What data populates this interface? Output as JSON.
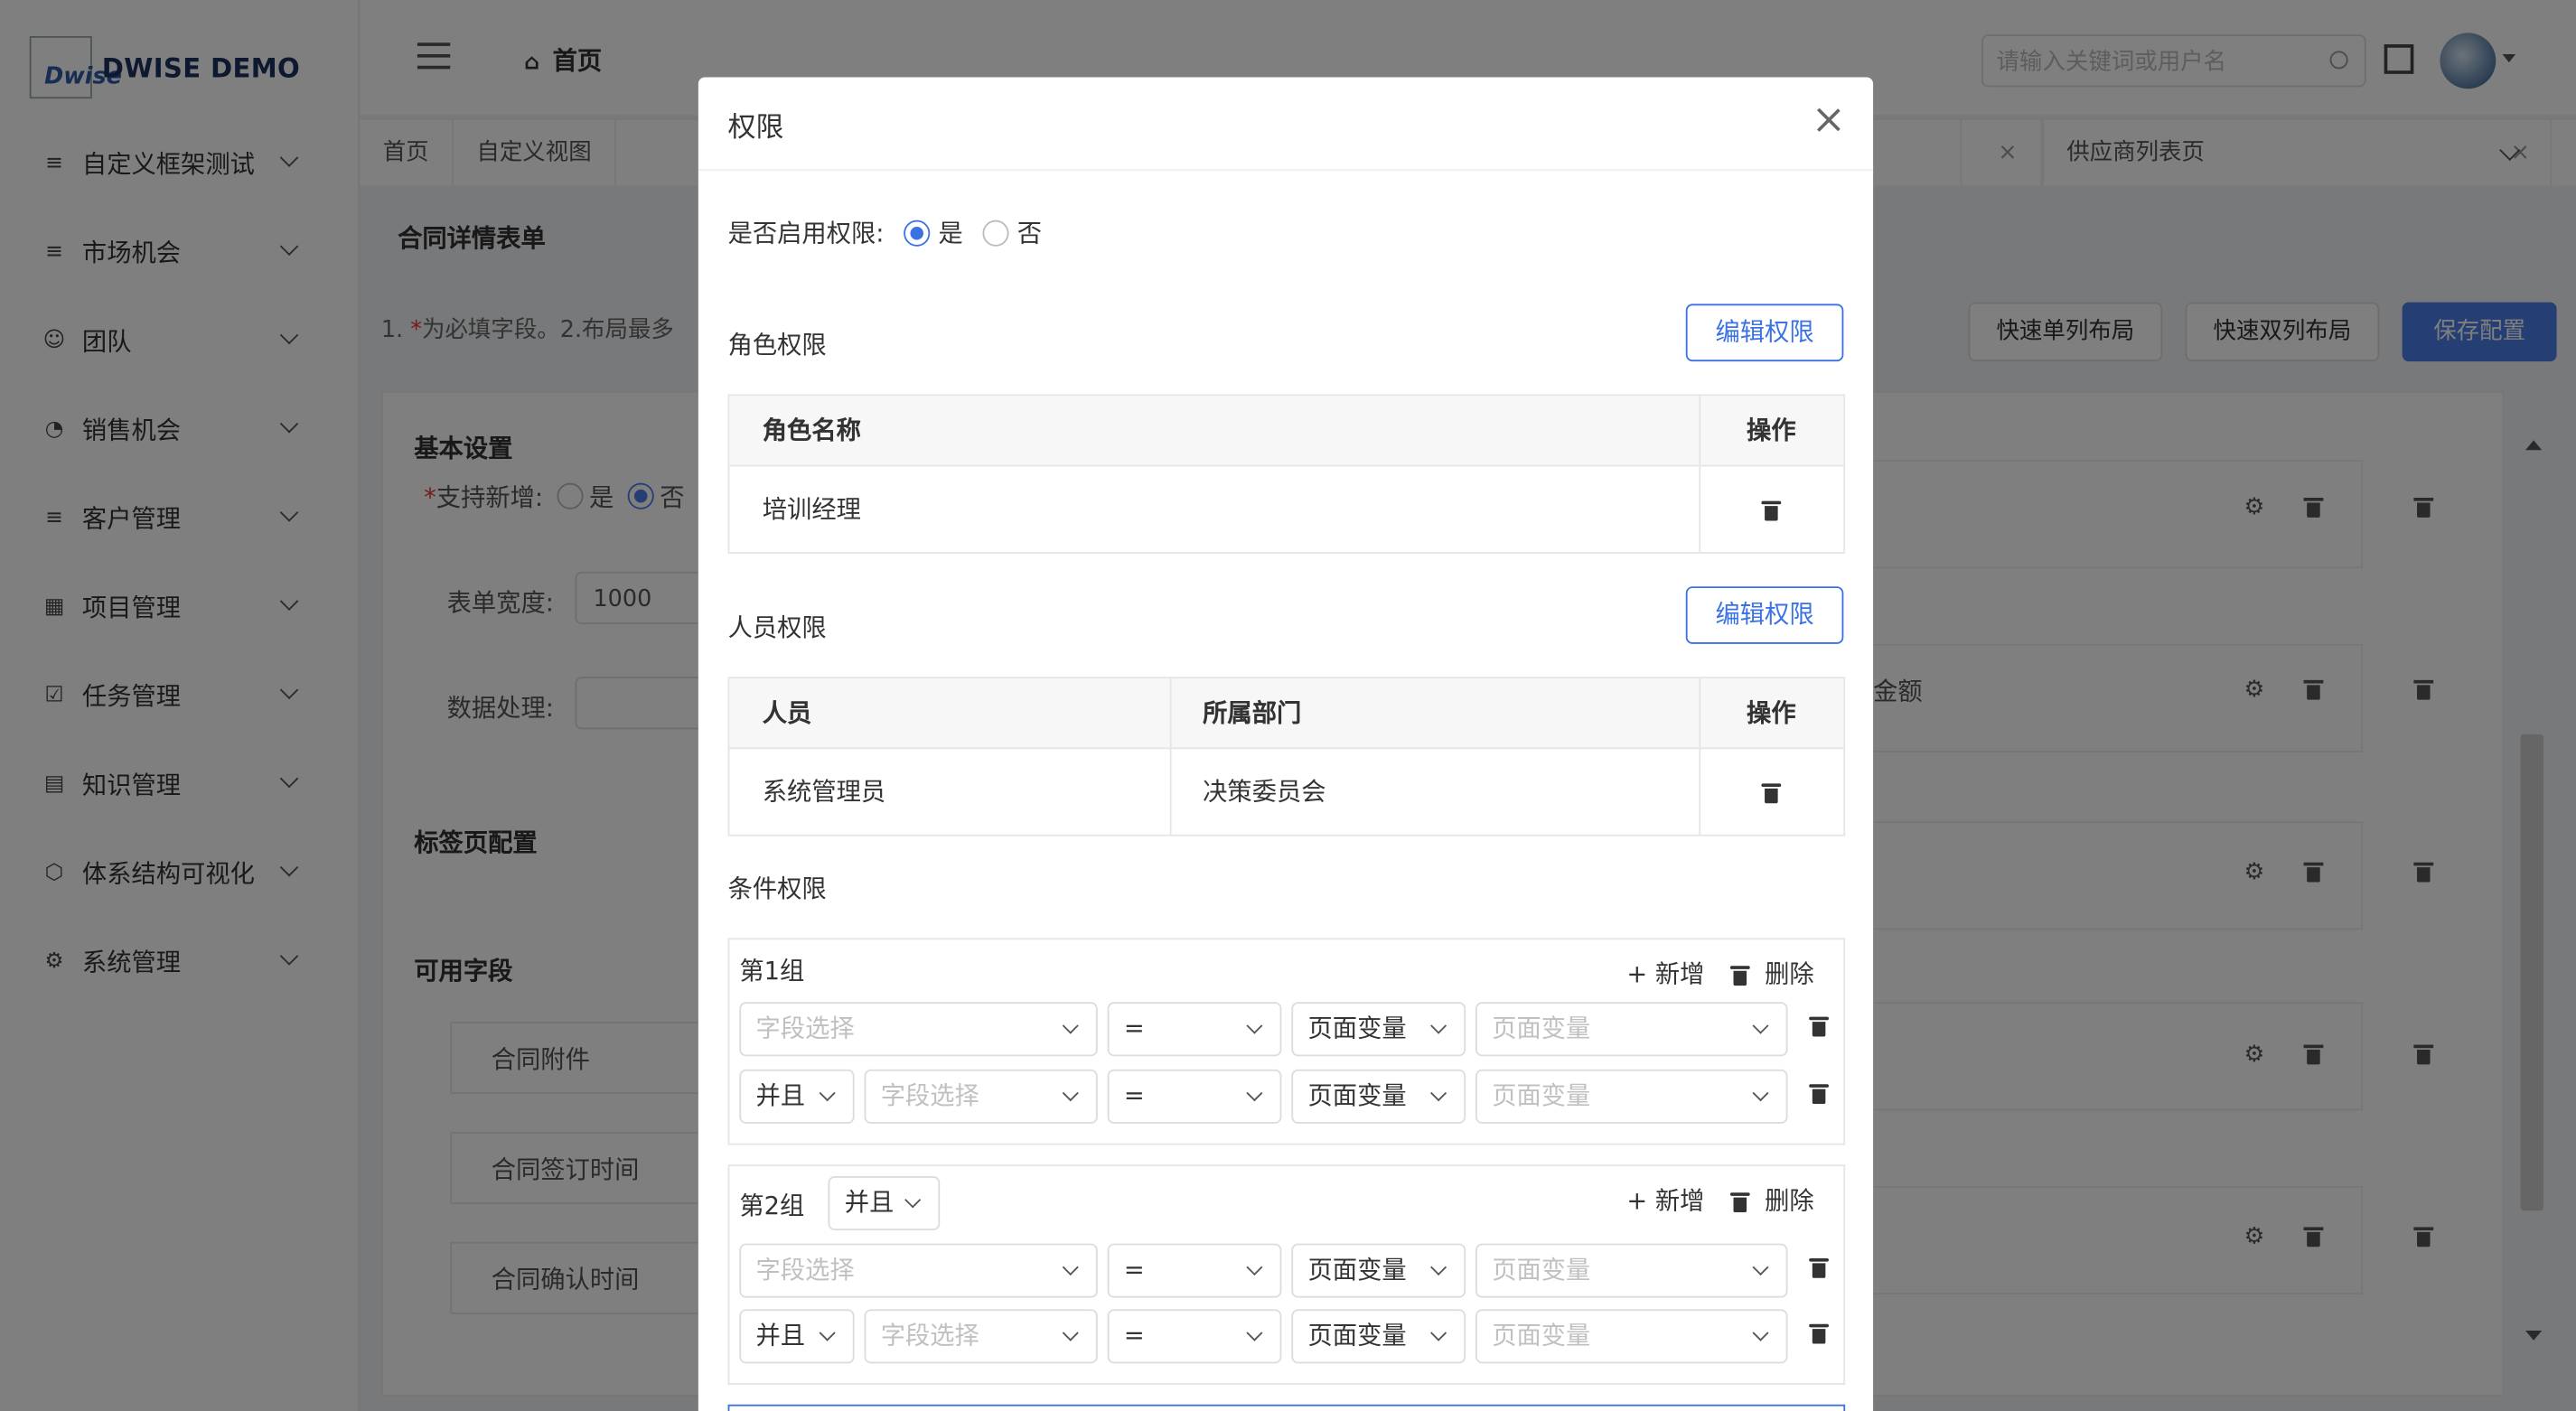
{
  "app": {
    "logo_text": "Dwise",
    "brand": "DWISE DEMO"
  },
  "sidebar": {
    "items": [
      {
        "label": "自定义框架测试",
        "icon": "list-icon"
      },
      {
        "label": "市场机会",
        "icon": "list-icon"
      },
      {
        "label": "团队",
        "icon": "team-icon"
      },
      {
        "label": "销售机会",
        "icon": "pie-icon"
      },
      {
        "label": "客户管理",
        "icon": "list-icon"
      },
      {
        "label": "项目管理",
        "icon": "grid-icon"
      },
      {
        "label": "任务管理",
        "icon": "calendar-check-icon"
      },
      {
        "label": "知识管理",
        "icon": "book-icon"
      },
      {
        "label": "体系结构可视化",
        "icon": "hexagon-icon"
      },
      {
        "label": "系统管理",
        "icon": "gear-icon"
      }
    ]
  },
  "header": {
    "breadcrumb": "首页",
    "search_placeholder": "请输入关键词或用户名"
  },
  "tabs": {
    "left": [
      "首页",
      "自定义视图"
    ],
    "right_close": "×",
    "right": [
      {
        "label": "供应商列表页",
        "close": "×"
      }
    ]
  },
  "page": {
    "title": "合同详情表单",
    "hint_prefix": "1. ",
    "hint_star": "*",
    "hint_text": "为必填字段。2.布局最多",
    "btn_single": "快速单列布局",
    "btn_double": "快速双列布局",
    "btn_save": "保存配置",
    "basic_settings": "基本设置",
    "support_add_label": "支持新增:",
    "support_add_yes": "是",
    "support_add_no": "否",
    "width_label": "表单宽度:",
    "width_value": "1000",
    "data_label": "数据处理:",
    "tab_config": "标签页配置",
    "available_fields": "可用字段",
    "fields": [
      "合同附件",
      "合同签订时间",
      "合同确认时间"
    ],
    "right_partial_label": "金额"
  },
  "modal": {
    "title": "权限",
    "enable_label": "是否启用权限:",
    "enable_yes": "是",
    "enable_no": "否",
    "enabled": true,
    "role_section": "角色权限",
    "edit_btn": "编辑权限",
    "role_table": {
      "headers": [
        "角色名称",
        "操作"
      ],
      "rows": [
        [
          "培训经理"
        ]
      ]
    },
    "user_section": "人员权限",
    "user_table": {
      "headers": [
        "人员",
        "所属部门",
        "操作"
      ],
      "rows": [
        [
          "系统管理员",
          "决策委员会"
        ]
      ]
    },
    "cond_section": "条件权限",
    "add_label": "+ 新增",
    "del_label": "删除",
    "groups": [
      {
        "title": "第1组",
        "rows": [
          {
            "field": "字段选择",
            "op": "=",
            "type": "页面变量",
            "value": "页面变量"
          },
          {
            "logic": "并且",
            "field": "字段选择",
            "op": "=",
            "type": "页面变量",
            "value": "页面变量"
          }
        ]
      },
      {
        "title": "第2组",
        "logic": "并且",
        "rows": [
          {
            "field": "字段选择",
            "op": "=",
            "type": "页面变量",
            "value": "页面变量"
          },
          {
            "logic": "并且",
            "field": "字段选择",
            "op": "=",
            "type": "页面变量",
            "value": "页面变量"
          }
        ]
      }
    ]
  }
}
